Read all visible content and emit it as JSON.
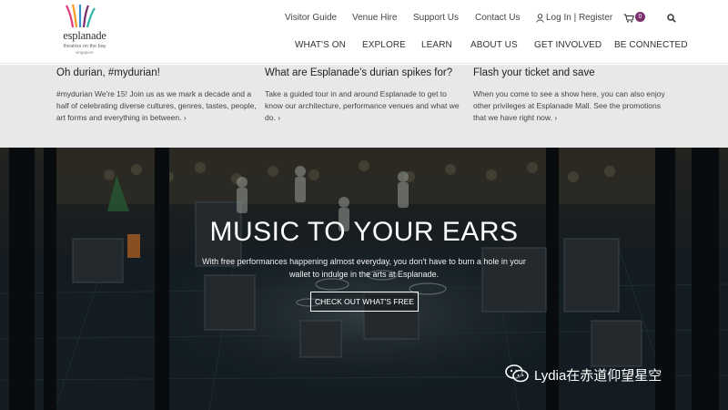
{
  "brand": {
    "name": "esplanade",
    "tagline": "theatres on the bay",
    "country": "singapore"
  },
  "utility_nav": [
    "Visitor Guide",
    "Venue Hire",
    "Support Us",
    "Contact Us"
  ],
  "account": {
    "login_label": "Log In | Register",
    "cart_count": "0"
  },
  "main_nav": [
    "WHAT'S ON",
    "EXPLORE",
    "LEARN",
    "ABOUT US",
    "GET INVOLVED",
    "BE CONNECTED"
  ],
  "info_columns": [
    {
      "title": "Oh durian, #mydurian!",
      "body": "#mydurian We're 15! Join us as we mark a decade and a half of celebrating diverse cultures, genres, tastes, people, art forms and everything in between.",
      "more": "›"
    },
    {
      "title": "What are Esplanade's durian spikes for?",
      "body": "Take a guided tour in and around Esplanade to get to know our architecture, performance venues and what we do.",
      "more": "›"
    },
    {
      "title": "Flash your ticket and save",
      "body": "When you come to see a show here, you can also enjoy other privileges at Esplanade Mall. See the promotions that we have right now.",
      "more": "›"
    }
  ],
  "hero": {
    "title": "MUSIC TO YOUR EARS",
    "subtitle": "With free performances happening almost everyday, you don't have to burn a hole in your wallet to indulge in the arts at Esplanade.",
    "button_label": "CHECK OUT WHAT'S FREE"
  },
  "watermark": {
    "text": "Lydia在赤道仰望星空"
  },
  "icons": {
    "user": "user-icon",
    "cart": "cart-icon",
    "search": "search-icon",
    "wechat": "wechat-icon"
  },
  "colors": {
    "accent": "#7c2f6d",
    "info_bg": "#e8e8e8",
    "hero_bg": "#141c22"
  }
}
